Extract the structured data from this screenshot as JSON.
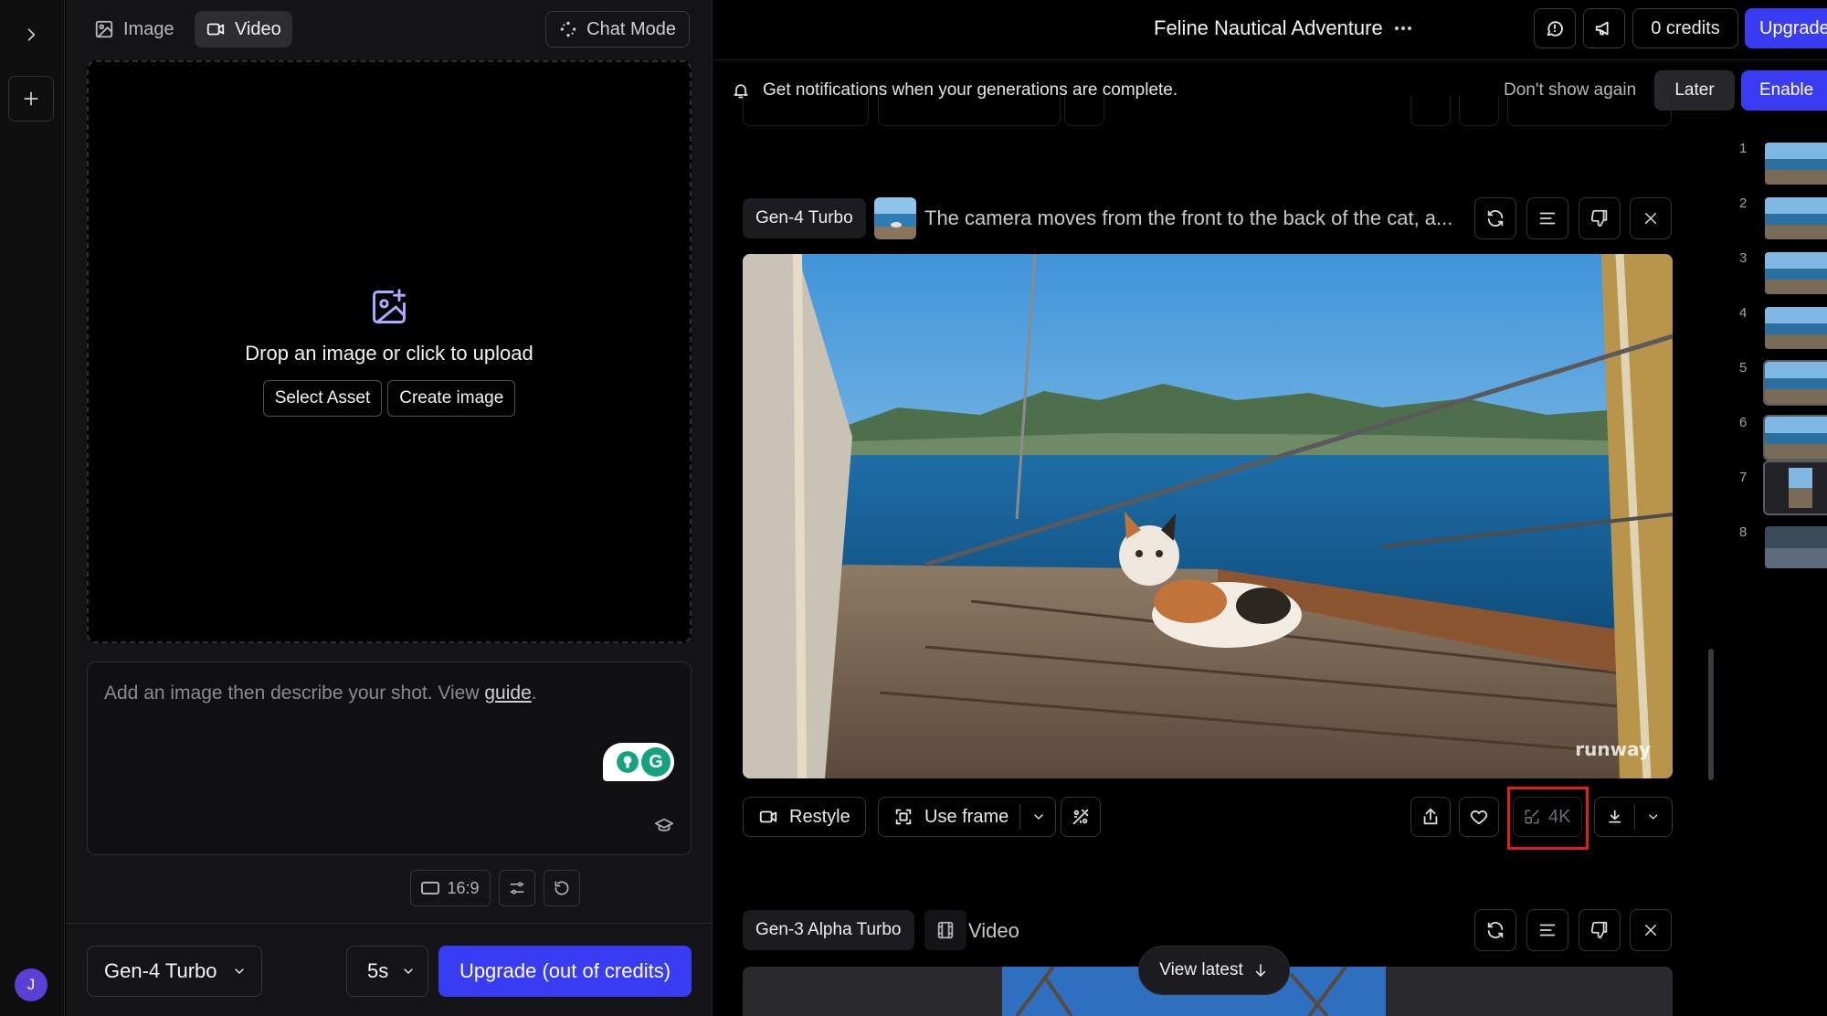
{
  "sidebar": {
    "expand_icon": "chevron-right-icon",
    "new_icon": "plus-icon",
    "avatar_initial": "J"
  },
  "left_panel": {
    "tabs": [
      {
        "label": "Image",
        "icon": "image-icon",
        "active": false
      },
      {
        "label": "Video",
        "icon": "video-camera-icon",
        "active": true
      }
    ],
    "chat_mode_label": "Chat Mode",
    "upload": {
      "icon": "image-plus-icon",
      "text": "Drop an image or click to upload",
      "select_asset_label": "Select Asset",
      "create_image_label": "Create image"
    },
    "prompt": {
      "placeholder_prefix": "Add an image then describe your shot. View ",
      "guide_link": "guide",
      "placeholder_suffix": "."
    },
    "tools": {
      "aspect_ratio": "16:9"
    },
    "footer": {
      "model": "Gen-4 Turbo",
      "duration": "5s",
      "upgrade_label": "Upgrade (out of credits)"
    }
  },
  "header": {
    "project_title": "Feline Nautical Adventure",
    "more_icon": "ellipsis-icon",
    "credits_label": "0 credits",
    "upgrade_label": "Upgrade"
  },
  "notification": {
    "text": "Get notifications when your generations are complete.",
    "dont_show_label": "Don't show again",
    "later_label": "Later",
    "enable_label": "Enable"
  },
  "generations": [
    {
      "model": "Gen-4 Turbo",
      "prompt": "The camera moves from the front to the back of the cat, a...",
      "watermark": "runway",
      "actions": {
        "restyle_label": "Restyle",
        "use_frame_label": "Use frame",
        "upscale_label": "4K"
      }
    },
    {
      "model": "Gen-3 Alpha Turbo",
      "type_label": "Video"
    }
  ],
  "view_latest_label": "View latest",
  "thumbnails": [
    "1",
    "2",
    "3",
    "4",
    "5",
    "6",
    "7",
    "8"
  ],
  "colors": {
    "accent": "#3a3cf4",
    "highlight": "#e02020"
  }
}
